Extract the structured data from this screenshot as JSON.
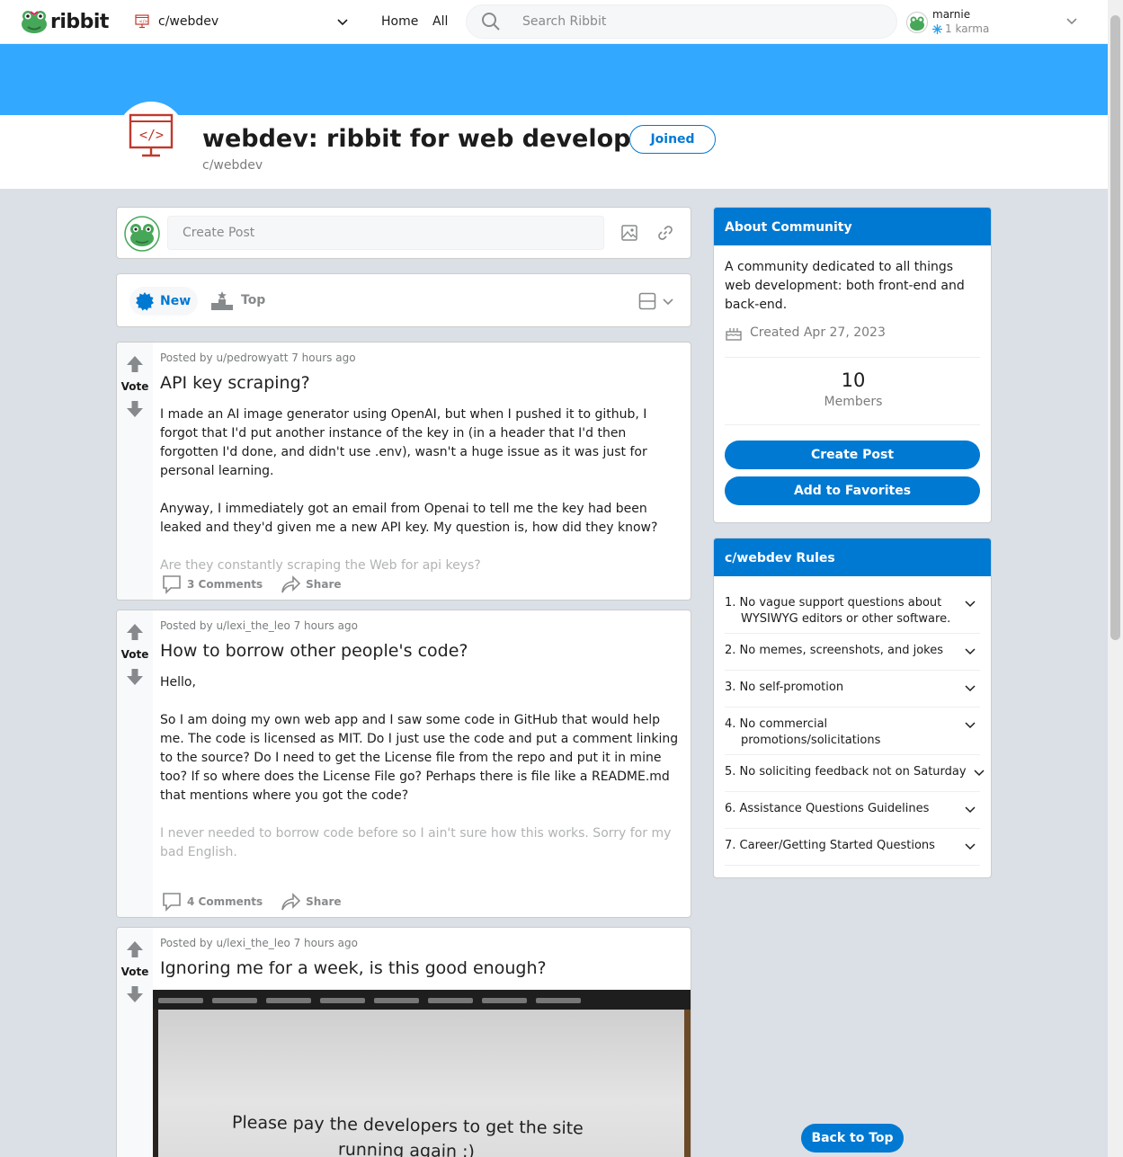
{
  "brand": {
    "name": "ribbit"
  },
  "nav": {
    "community": "c/webdev",
    "home": "Home",
    "all": "All",
    "search_placeholder": "Search Ribbit",
    "user_name": "marnie",
    "user_karma": "1 karma"
  },
  "community": {
    "title": "webdev: ribbit for web developers",
    "name": "c/webdev",
    "joined_label": "Joined"
  },
  "create_post": {
    "placeholder": "Create Post"
  },
  "sort": {
    "new": "New",
    "top": "Top"
  },
  "posts": [
    {
      "meta": "Posted by u/pedrowyatt 7 hours ago",
      "vote": "Vote",
      "title": "API key scraping?",
      "paragraphs": [
        "I made an AI image generator using OpenAI, but when I pushed it to github, I forgot that I'd put another instance of the key in (in a header that I'd then forgotten I'd done, and didn't use .env), wasn't a huge issue as it was just for personal learning.",
        "Anyway, I immediately got an email from Openai to tell me the key had been leaked and they'd given me a new API key. My question is, how did they know?",
        "Are they constantly scraping the Web for api keys?"
      ],
      "comments": "3 Comments",
      "share": "Share"
    },
    {
      "meta": "Posted by u/lexi_the_leo 7 hours ago",
      "vote": "Vote",
      "title": "How to borrow other people's code?",
      "paragraphs": [
        "Hello,",
        "So I am doing my own web app and I saw some code in GitHub that would help me. The code is licensed as MIT. Do I just use the code and put a comment linking to the source? Do I need to get the License file from the repo and put it in mine too? If so where does the License File go? Perhaps there is file like a README.md that mentions where you got the code?",
        "I never needed to borrow code before so I ain't sure how this works. Sorry for my bad English."
      ],
      "comments": "4 Comments",
      "share": "Share"
    },
    {
      "meta": "Posted by u/lexi_the_leo 7 hours ago",
      "vote": "Vote",
      "title": "Ignoring me for a week, is this good enough?",
      "image_text_1": "Please pay the developers to get the site",
      "image_text_2": "running again :)"
    }
  ],
  "about": {
    "header": "About Community",
    "description": "A community dedicated to all things web development: both front-end and back-end.",
    "created": "Created Apr 27, 2023",
    "members_count": "10",
    "members_label": "Members",
    "create_post": "Create Post",
    "add_favorites": "Add to Favorites"
  },
  "rules": {
    "header": "c/webdev Rules",
    "items": [
      "1. No vague support questions about WYSIWYG editors or other software.",
      "2. No memes, screenshots, and jokes",
      "3. No self-promotion",
      "4. No commercial promotions/solicitations",
      "5. No soliciting feedback not on Saturday",
      "6. Assistance Questions Guidelines",
      "7. Career/Getting Started Questions"
    ]
  },
  "back_to_top": "Back to Top",
  "colors": {
    "accent": "#0079d3",
    "banner": "#33a8ff",
    "background": "#dae0e6",
    "frog_green": "#46a758",
    "icon_red": "#c0392b"
  },
  "icons": [
    "frog-logo-icon",
    "community-code-icon",
    "chevron-down-icon",
    "search-icon",
    "snowflake-icon",
    "image-icon",
    "link-icon",
    "burst-icon",
    "podium-icon",
    "card-layout-icon",
    "upvote-icon",
    "downvote-icon",
    "comment-icon",
    "share-icon",
    "cake-icon"
  ]
}
